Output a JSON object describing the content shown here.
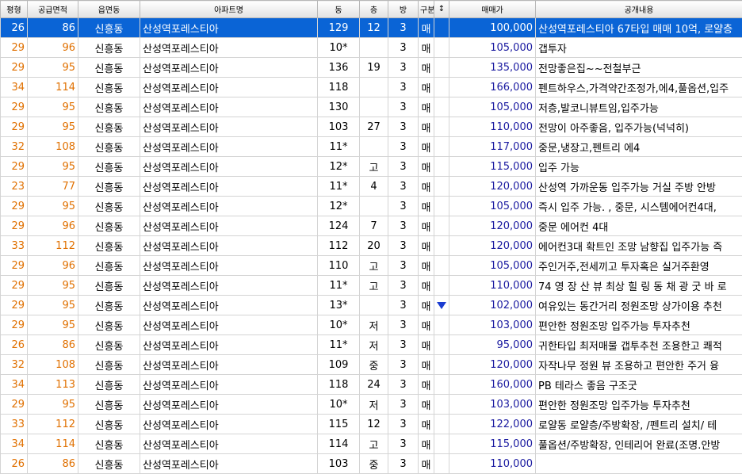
{
  "table": {
    "headers": [
      "평형",
      "공급면적",
      "읍면동",
      "아파트명",
      "동",
      "층",
      "방",
      "구분",
      "↕",
      "매매가",
      "공개내용"
    ],
    "rows": [
      {
        "py": "26",
        "area": "86",
        "dong_name": "신흥동",
        "apt": "산성역포레스티아",
        "bldg": "129",
        "floor": "12",
        "rooms": "3",
        "type": "매",
        "mark": "",
        "price": "100,000",
        "desc": "산성역포레스티아 67타입 매매 10억, 로얄층",
        "selected": true
      },
      {
        "py": "29",
        "area": "96",
        "dong_name": "신흥동",
        "apt": "산성역포레스티아",
        "bldg": "10*",
        "floor": "",
        "rooms": "3",
        "type": "매",
        "mark": "",
        "price": "105,000",
        "desc": "갭투자"
      },
      {
        "py": "29",
        "area": "95",
        "dong_name": "신흥동",
        "apt": "산성역포레스티아",
        "bldg": "136",
        "floor": "19",
        "rooms": "3",
        "type": "매",
        "mark": "",
        "price": "135,000",
        "desc": "전망좋은집~~전철부근"
      },
      {
        "py": "34",
        "area": "114",
        "dong_name": "신흥동",
        "apt": "산성역포레스티아",
        "bldg": "118",
        "floor": "",
        "rooms": "3",
        "type": "매",
        "mark": "",
        "price": "166,000",
        "desc": "펜트하우스,가격약간조정가,에4,풀옵션,입주"
      },
      {
        "py": "29",
        "area": "95",
        "dong_name": "신흥동",
        "apt": "산성역포레스티아",
        "bldg": "130",
        "floor": "",
        "rooms": "3",
        "type": "매",
        "mark": "",
        "price": "105,000",
        "desc": "저층,발코니뷰트임,입주가능"
      },
      {
        "py": "29",
        "area": "95",
        "dong_name": "신흥동",
        "apt": "산성역포레스티아",
        "bldg": "103",
        "floor": "27",
        "rooms": "3",
        "type": "매",
        "mark": "",
        "price": "110,000",
        "desc": "전망이 아주좋음,  입주가능(넉넉히)"
      },
      {
        "py": "32",
        "area": "108",
        "dong_name": "신흥동",
        "apt": "산성역포레스티아",
        "bldg": "11*",
        "floor": "",
        "rooms": "3",
        "type": "매",
        "mark": "",
        "price": "117,000",
        "desc": "중문,냉장고,펜트리 에4"
      },
      {
        "py": "29",
        "area": "95",
        "dong_name": "신흥동",
        "apt": "산성역포레스티아",
        "bldg": "12*",
        "floor": "고",
        "rooms": "3",
        "type": "매",
        "mark": "",
        "price": "115,000",
        "desc": "입주 가능"
      },
      {
        "py": "23",
        "area": "77",
        "dong_name": "신흥동",
        "apt": "산성역포레스티아",
        "bldg": "11*",
        "floor": "4",
        "rooms": "3",
        "type": "매",
        "mark": "",
        "price": "120,000",
        "desc": "산성역 가까운동 입주가능  거실 주방 안방"
      },
      {
        "py": "29",
        "area": "95",
        "dong_name": "신흥동",
        "apt": "산성역포레스티아",
        "bldg": "12*",
        "floor": "",
        "rooms": "3",
        "type": "매",
        "mark": "",
        "price": "105,000",
        "desc": "즉시 입주 가능. , 중문, 시스템에어컨4대,"
      },
      {
        "py": "29",
        "area": "96",
        "dong_name": "신흥동",
        "apt": "산성역포레스티아",
        "bldg": "124",
        "floor": "7",
        "rooms": "3",
        "type": "매",
        "mark": "",
        "price": "120,000",
        "desc": "중문 에어컨 4대"
      },
      {
        "py": "33",
        "area": "112",
        "dong_name": "신흥동",
        "apt": "산성역포레스티아",
        "bldg": "112",
        "floor": "20",
        "rooms": "3",
        "type": "매",
        "mark": "",
        "price": "120,000",
        "desc": "에어컨3대  확트인 조망 남향집 입주가능 즉"
      },
      {
        "py": "29",
        "area": "96",
        "dong_name": "신흥동",
        "apt": "산성역포레스티아",
        "bldg": "110",
        "floor": "고",
        "rooms": "3",
        "type": "매",
        "mark": "",
        "price": "105,000",
        "desc": "주인거주,전세끼고 투자혹은 실거주환영"
      },
      {
        "py": "29",
        "area": "95",
        "dong_name": "신흥동",
        "apt": "산성역포레스티아",
        "bldg": "11*",
        "floor": "고",
        "rooms": "3",
        "type": "매",
        "mark": "",
        "price": "110,000",
        "desc": "74 영 장 산 뷰 최상 힐 링 동 채 광 굿 바 로"
      },
      {
        "py": "29",
        "area": "95",
        "dong_name": "신흥동",
        "apt": "산성역포레스티아",
        "bldg": "13*",
        "floor": "",
        "rooms": "3",
        "type": "매",
        "mark": "down",
        "price": "102,000",
        "desc": "여유있는 동간거리 정원조망 상가이용 추천"
      },
      {
        "py": "29",
        "area": "95",
        "dong_name": "신흥동",
        "apt": "산성역포레스티아",
        "bldg": "10*",
        "floor": "저",
        "rooms": "3",
        "type": "매",
        "mark": "",
        "price": "103,000",
        "desc": "편안한 정원조망 입주가능 투자추천"
      },
      {
        "py": "26",
        "area": "86",
        "dong_name": "신흥동",
        "apt": "산성역포레스티아",
        "bldg": "11*",
        "floor": "저",
        "rooms": "3",
        "type": "매",
        "mark": "",
        "price": "95,000",
        "desc": "귀한타입 최저매물 갭투추천 조용한고 쾌적"
      },
      {
        "py": "32",
        "area": "108",
        "dong_name": "신흥동",
        "apt": "산성역포레스티아",
        "bldg": "109",
        "floor": "중",
        "rooms": "3",
        "type": "매",
        "mark": "",
        "price": "120,000",
        "desc": "자작나무 정원 뷰 조용하고 편안한 주거 융"
      },
      {
        "py": "34",
        "area": "113",
        "dong_name": "신흥동",
        "apt": "산성역포레스티아",
        "bldg": "118",
        "floor": "24",
        "rooms": "3",
        "type": "매",
        "mark": "",
        "price": "160,000",
        "desc": "PB 테라스 좋음 구조굿"
      },
      {
        "py": "29",
        "area": "95",
        "dong_name": "신흥동",
        "apt": "산성역포레스티아",
        "bldg": "10*",
        "floor": "저",
        "rooms": "3",
        "type": "매",
        "mark": "",
        "price": "103,000",
        "desc": "편안한 정원조망 입주가능 투자추천"
      },
      {
        "py": "33",
        "area": "112",
        "dong_name": "신흥동",
        "apt": "산성역포레스티아",
        "bldg": "115",
        "floor": "12",
        "rooms": "3",
        "type": "매",
        "mark": "",
        "price": "122,000",
        "desc": "로얄동 로얄층/주방확장, /펜트리 설치/ 테"
      },
      {
        "py": "34",
        "area": "114",
        "dong_name": "신흥동",
        "apt": "산성역포레스티아",
        "bldg": "114",
        "floor": "고",
        "rooms": "3",
        "type": "매",
        "mark": "",
        "price": "115,000",
        "desc": "풀옵션/주방확장, 인테리어 완료(조명.안방"
      },
      {
        "py": "26",
        "area": "86",
        "dong_name": "신흥동",
        "apt": "산성역포레스티아",
        "bldg": "103",
        "floor": "중",
        "rooms": "3",
        "type": "매",
        "mark": "",
        "price": "110,000",
        "desc": ""
      }
    ]
  }
}
